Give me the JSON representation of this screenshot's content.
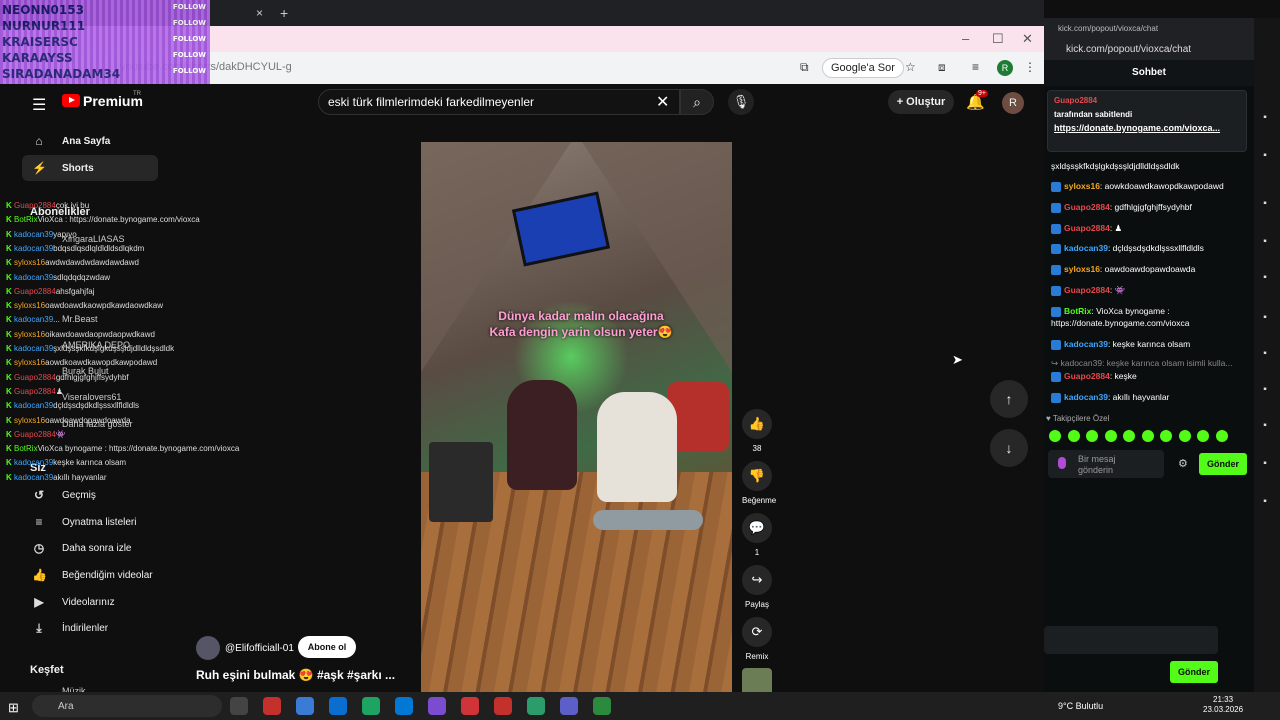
{
  "browser": {
    "new_tab": "+",
    "tab_close": "×",
    "url": "youtube.com/shorts/dakDHCYUL-g",
    "google_sor": "Google'a Sor",
    "profile_letter": "R",
    "window_controls": [
      "–",
      "☐",
      "✕"
    ]
  },
  "overlay": {
    "rows": [
      {
        "name": "NEONN0153",
        "tag": "FOLLOW"
      },
      {
        "name": "NURNUR111",
        "tag": "FOLLOW"
      },
      {
        "name": "KRAISERSC",
        "tag": "FOLLOW"
      },
      {
        "name": "KARAAYSS",
        "tag": "FOLLOW"
      },
      {
        "name": "SIRADANADAM34",
        "tag": "FOLLOW"
      }
    ]
  },
  "youtube": {
    "premium": "Premium",
    "tr": "TR",
    "search_query": "eski türk filmlerimdeki farkedilmeyenler",
    "create": "Oluştur",
    "bell_badge": "9+",
    "avatar_letter": "R",
    "sidebar": {
      "home": "Ana Sayfa",
      "shorts": "Shorts",
      "subscriptions": "Abonelikler",
      "subs": [
        "XingaraLIASAS",
        "Mr.Beast",
        "AMERIKA DEPO",
        "Burak Bulut",
        "Viseralovers61"
      ],
      "show_more": "Daha fazla göster",
      "you": "Siz",
      "history": "Geçmiş",
      "playlists": "Oynatma listeleri",
      "watch_later": "Daha sonra izle",
      "liked": "Beğendiğim videolar",
      "your_videos": "Videolarınız",
      "downloads": "İndirilenler",
      "explore": "Keşfet",
      "music": "Müzik"
    },
    "video": {
      "caption_line1": "Dünya kadar malın olacağına",
      "caption_line2": "Kafa dengin yarin olsun yeter😍",
      "channel": "@Elifofficiall-01",
      "subscribe": "Abone ol",
      "title": "Ruh eşini bulmak 😍 #aşk #şarkı ..."
    },
    "actions": {
      "likes": "38",
      "dislike": "Beğenme",
      "comments": "1",
      "share": "Paylaş",
      "remix": "Remix"
    }
  },
  "overlay_chat": [
    {
      "user": "Guapo2884",
      "msg": "çok iyi bu"
    },
    {
      "user": "BotRix",
      "msg": "VioXca : https://donate.bynogame.com/vioxca"
    },
    {
      "user": "kadocan39",
      "msg": "yapıyo"
    },
    {
      "user": "kadocan39",
      "msg": "bdqsdlqsdlqldldldsdlqkdm"
    },
    {
      "user": "syloxs16",
      "msg": "awdwdawdwdawdawdawd"
    },
    {
      "user": "kadocan39",
      "msg": "sdlqdqdqzwdaw"
    },
    {
      "user": "Guapo2884",
      "msg": "ahsfgahjfaj"
    },
    {
      "user": "syloxs16",
      "msg": "oawdoawdkaowpdkawdaowdkaw"
    },
    {
      "user": "kadocan39",
      "msg": "..."
    },
    {
      "user": "syloxs16",
      "msg": "oikawdoawdaopwdaopwdkawd"
    },
    {
      "user": "kadocan39",
      "msg": "şxldşsşkfkdşlgkdşsşldjdlldldşsdldk"
    },
    {
      "user": "syloxs16",
      "msg": "aowdkoawdkawopdkawpodawd"
    },
    {
      "user": "Guapo2884",
      "msg": "gdfhlgjgfghjffsydyhbf"
    },
    {
      "user": "Guapo2884",
      "msg": "♟"
    },
    {
      "user": "kadocan39",
      "msg": "dçldşsdşdkdlşssxllfldldls"
    },
    {
      "user": "syloxs16",
      "msg": "oawdoawdopawdoawda"
    },
    {
      "user": "Guapo2884",
      "msg": "👾"
    },
    {
      "user": "BotRix",
      "msg": "VioXca bynogame : https://donate.bynogame.com/vioxca"
    },
    {
      "user": "kadocan39",
      "msg": "keşke karıncа olsam"
    },
    {
      "user": "kadocan39",
      "msg": "akıllı hayvanlar"
    }
  ],
  "kick": {
    "title": "kick.com/popout/vioxca/chat",
    "url": "kick.com/popout/vioxca/chat",
    "header": "Sohbet",
    "pinned_user": "Guapo2884",
    "pinned_by": "tarafından sabitlendi",
    "pinned_link": "https://donate.bynogame.com/vioxca...",
    "messages": [
      {
        "user": "",
        "text": "şxldşsşkfkdşlgkdşsşldjdlldldşsdldk",
        "color": "#ffffff"
      },
      {
        "user": "syloxs16",
        "text": ": aowkdoawdkawopdkawpodawd",
        "color": "#f5a623"
      },
      {
        "user": "Guapo2884",
        "text": ": gdfhlgjgfghjffsydyhbf",
        "color": "#e5484d"
      },
      {
        "user": "Guapo2884",
        "text": ": ♟",
        "color": "#e5484d"
      },
      {
        "user": "kadocan39",
        "text": ": dçldşsdşdkdlşssxllfldldls",
        "color": "#3ea6ff"
      },
      {
        "user": "syloxs16",
        "text": ": oawdoawdopawdoawda",
        "color": "#f5a623"
      },
      {
        "user": "Guapo2884",
        "text": ": 👾",
        "color": "#e5484d"
      },
      {
        "user": "BotRix",
        "text": ": VioXca bynogame : https://donate.bynogame.com/vioxca",
        "color": "#53fc18"
      },
      {
        "user": "kadocan39",
        "text": ": keşke karıncа olsam",
        "color": "#3ea6ff"
      },
      {
        "user": "",
        "text": "↪ kadocan39: keşke karıncа olsam isimli kulla...",
        "color": "#888888"
      },
      {
        "user": "Guapo2884",
        "text": ": keşke",
        "color": "#e5484d"
      },
      {
        "user": "kadocan39",
        "text": ": akıllı hayvanlar",
        "color": "#3ea6ff"
      }
    ],
    "followers_label": "♥ Takipçilere Özel",
    "input_placeholder": "Bir mesaj gönderin",
    "send": "Gönder"
  },
  "taskbar": {
    "search": "Ara",
    "weather": "9°C Bulutlu",
    "time": "21:33",
    "date": "23.03.2026"
  }
}
